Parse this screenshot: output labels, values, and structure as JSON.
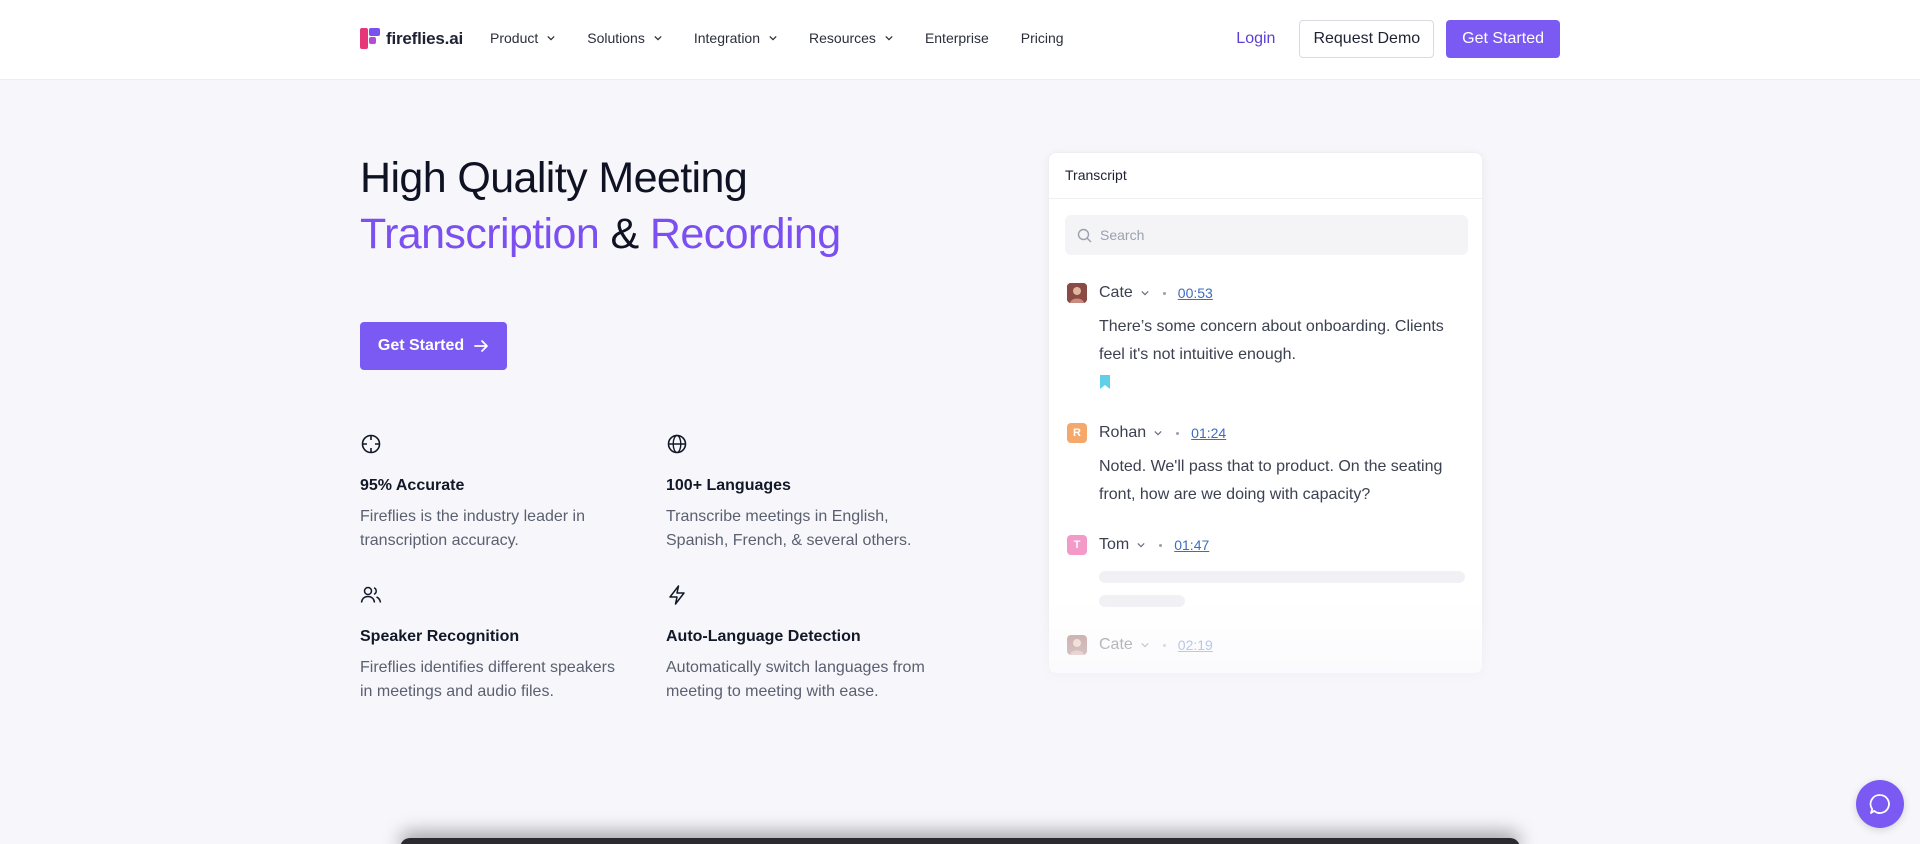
{
  "brand": {
    "name": "fireflies.ai",
    "colors": {
      "accent": "#7b5af4",
      "pink": "#e8367a",
      "purple": "#7b4ff0"
    }
  },
  "nav": {
    "items": [
      {
        "label": "Product",
        "has_menu": true
      },
      {
        "label": "Solutions",
        "has_menu": true
      },
      {
        "label": "Integration",
        "has_menu": true
      },
      {
        "label": "Resources",
        "has_menu": true
      },
      {
        "label": "Enterprise",
        "has_menu": false
      },
      {
        "label": "Pricing",
        "has_menu": false
      }
    ],
    "login_label": "Login",
    "request_demo_label": "Request Demo",
    "get_started_label": "Get Started"
  },
  "hero": {
    "title_line1": "High Quality Meeting",
    "title_accent1": "Transcription",
    "title_amp": " & ",
    "title_accent2": "Recording",
    "cta_label": "Get Started"
  },
  "features": [
    {
      "icon": "crosshair-icon",
      "title": "95% Accurate",
      "desc": "Fireflies is the industry leader in transcription accuracy."
    },
    {
      "icon": "globe-icon",
      "title": "100+ Languages",
      "desc": "Transcribe meetings in English, Spanish, French, & several others."
    },
    {
      "icon": "users-icon",
      "title": "Speaker Recognition",
      "desc": "Fireflies identifies different speakers in meetings and audio files."
    },
    {
      "icon": "lightning-icon",
      "title": "Auto-Language Detection",
      "desc": "Automatically switch languages from meeting to meeting with ease."
    }
  ],
  "transcript": {
    "title": "Transcript",
    "search_placeholder": "Search",
    "messages": [
      {
        "speaker": "Cate",
        "avatar": "photo",
        "time": "00:53",
        "text": "There’s some concern about onboarding. Clients feel it's not intuitive enough.",
        "bookmarked": true
      },
      {
        "speaker": "Rohan",
        "avatar_letter": "R",
        "avatar_color": "#f4a86b",
        "time": "01:24",
        "text": "Noted. We'll pass that to product. On the seating front, how are we doing with capacity?"
      },
      {
        "speaker": "Tom",
        "avatar_letter": "T",
        "avatar_color": "#f49ac8",
        "time": "01:47",
        "text": ""
      },
      {
        "speaker": "Cate",
        "avatar": "photo",
        "time": "02:19",
        "text": ""
      }
    ]
  },
  "chat": {
    "icon": "chat-bubble-icon"
  }
}
